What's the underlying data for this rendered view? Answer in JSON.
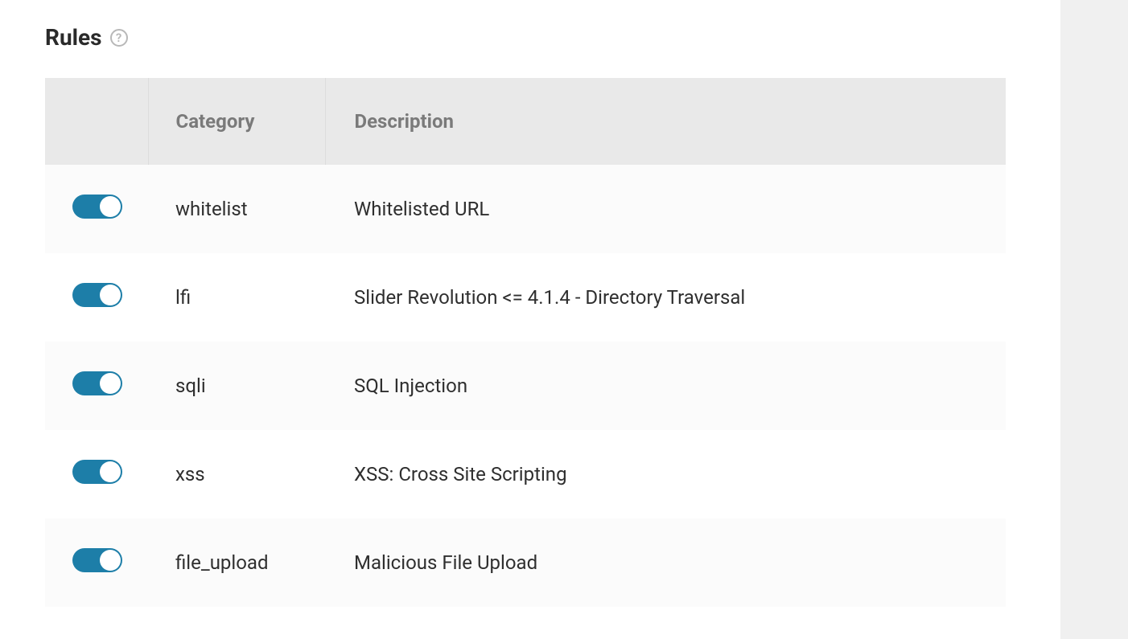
{
  "section": {
    "title": "Rules"
  },
  "table": {
    "headers": {
      "category": "Category",
      "description": "Description"
    },
    "rows": [
      {
        "enabled": true,
        "category": "whitelist",
        "description": "Whitelisted URL"
      },
      {
        "enabled": true,
        "category": "lfi",
        "description": "Slider Revolution <= 4.1.4 - Directory Traversal"
      },
      {
        "enabled": true,
        "category": "sqli",
        "description": "SQL Injection"
      },
      {
        "enabled": true,
        "category": "xss",
        "description": "XSS: Cross Site Scripting"
      },
      {
        "enabled": true,
        "category": "file_upload",
        "description": "Malicious File Upload"
      }
    ]
  }
}
